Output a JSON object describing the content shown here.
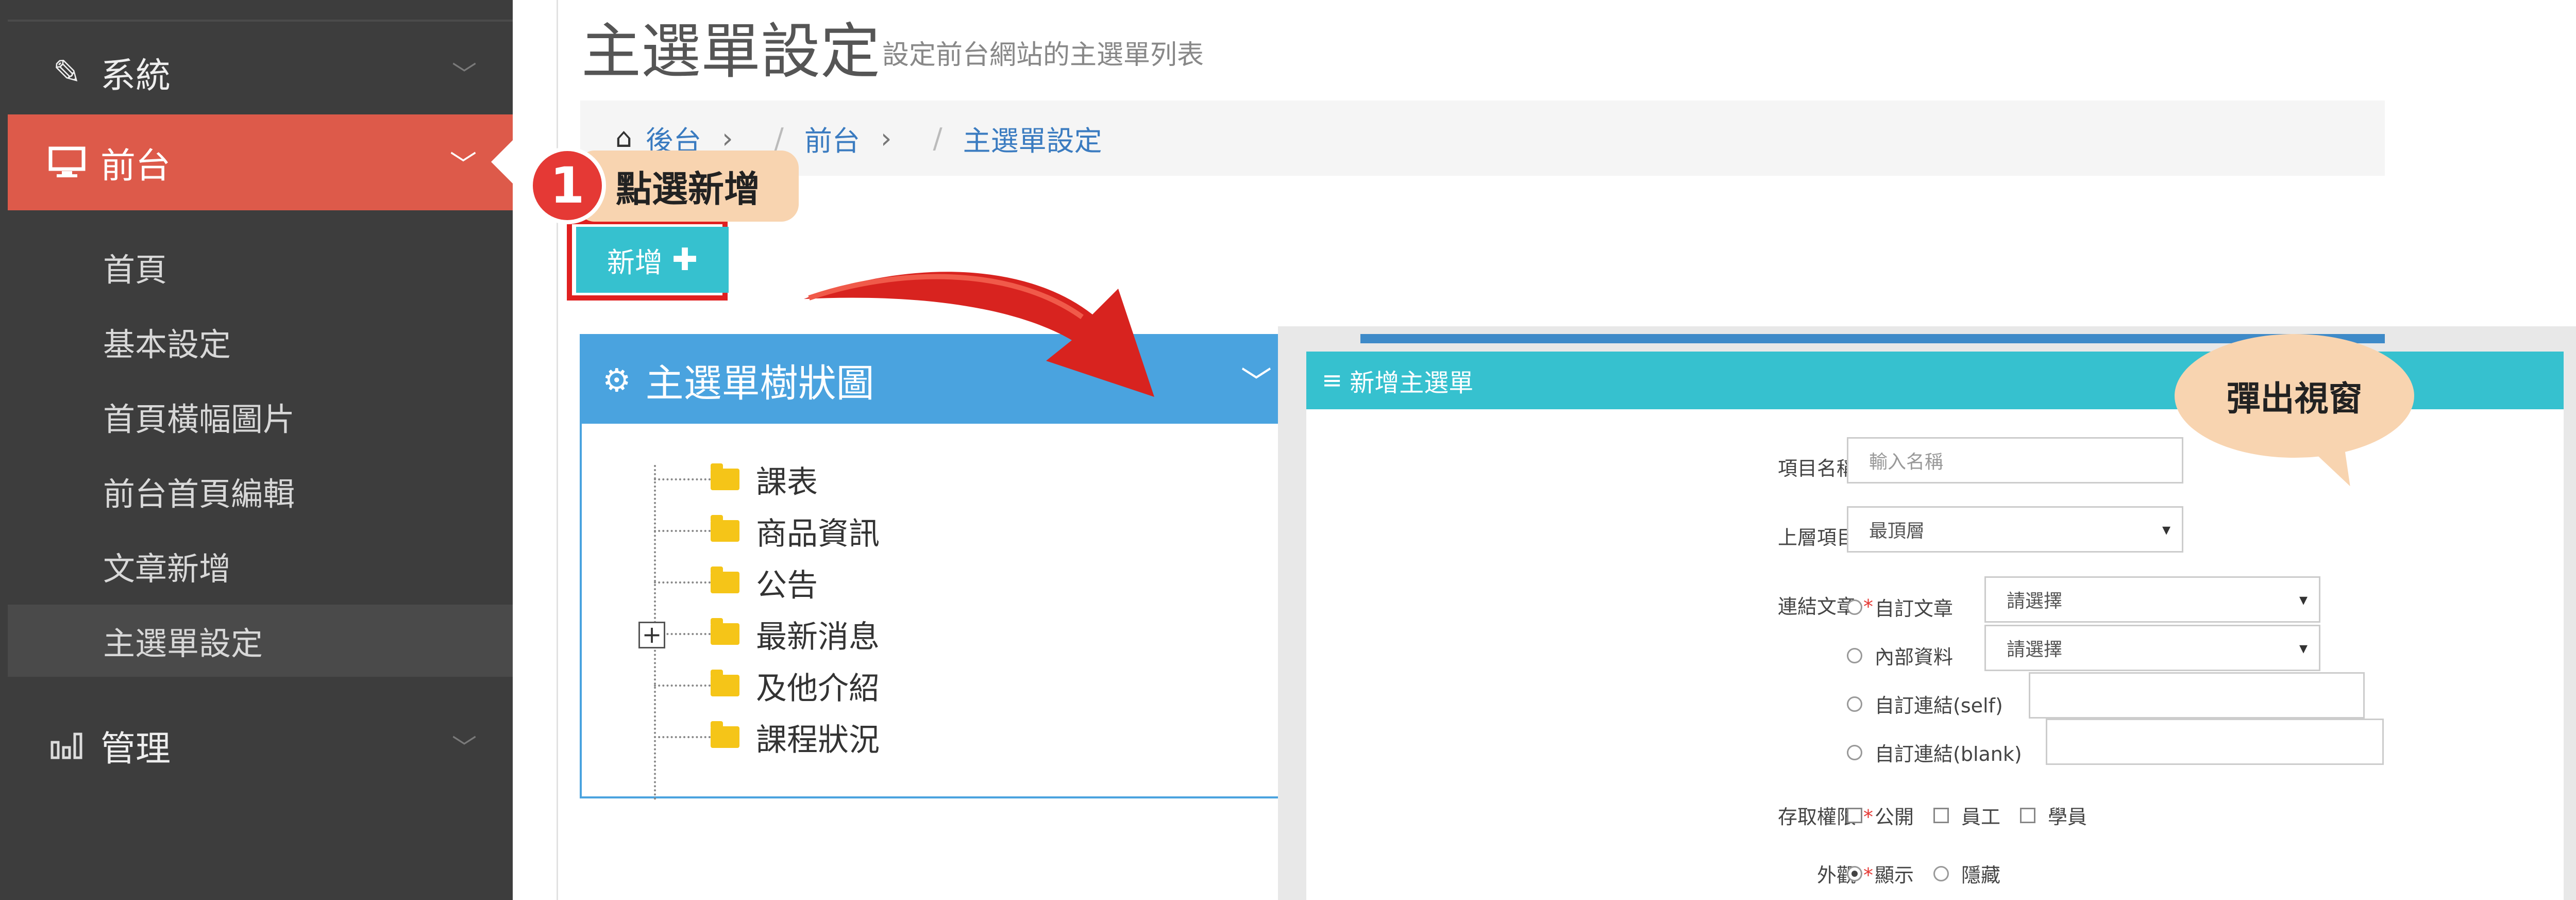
{
  "sidebar": {
    "system_label": "系統",
    "front_label": "前台",
    "manage_label": "管理",
    "sub_items": [
      "首頁",
      "基本設定",
      "首頁橫幅圖片",
      "前台首頁編輯",
      "文章新增",
      "主選單設定"
    ],
    "active_sub": "主選單設定",
    "colors": {
      "background": "#3d3d3d",
      "active": "#dd5a4a"
    }
  },
  "header": {
    "title": "主選單設定",
    "subtitle": "設定前台網站的主選單列表"
  },
  "breadcrumb": [
    "後台",
    "前台",
    "主選單設定"
  ],
  "annotations": {
    "step_number": "1",
    "step_label": "點選新增",
    "popup_label": "彈出視窗"
  },
  "toolbar": {
    "add_label": "新增",
    "add_icon": "plus-icon",
    "accent_color": "#36c1cf"
  },
  "tree": {
    "title": "主選單樹狀圖",
    "items": [
      {
        "label": "課表",
        "expandable": false
      },
      {
        "label": "商品資訊",
        "expandable": false
      },
      {
        "label": "公告",
        "expandable": false
      },
      {
        "label": "最新消息",
        "expandable": true
      },
      {
        "label": "及他介紹",
        "expandable": false
      },
      {
        "label": "課程狀況",
        "expandable": false
      }
    ]
  },
  "modal": {
    "title": "新增主選單",
    "fields": {
      "name": {
        "label": "項目名稱",
        "placeholder": "輸入名稱"
      },
      "parent": {
        "label": "上層項目",
        "value": "最頂層"
      },
      "link": {
        "label": "連結文章",
        "options": [
          {
            "label": "自訂文章",
            "value": "請選擇"
          },
          {
            "label": "內部資料",
            "value": "請選擇"
          },
          {
            "label": "自訂連結(self)",
            "value": ""
          },
          {
            "label": "自訂連結(blank)",
            "value": ""
          }
        ]
      },
      "access": {
        "label": "存取權限",
        "options": [
          "公開",
          "員工",
          "學員"
        ]
      },
      "visibility": {
        "label": "外觀",
        "options": [
          "顯示",
          "隱藏"
        ],
        "selected": "顯示"
      }
    }
  }
}
